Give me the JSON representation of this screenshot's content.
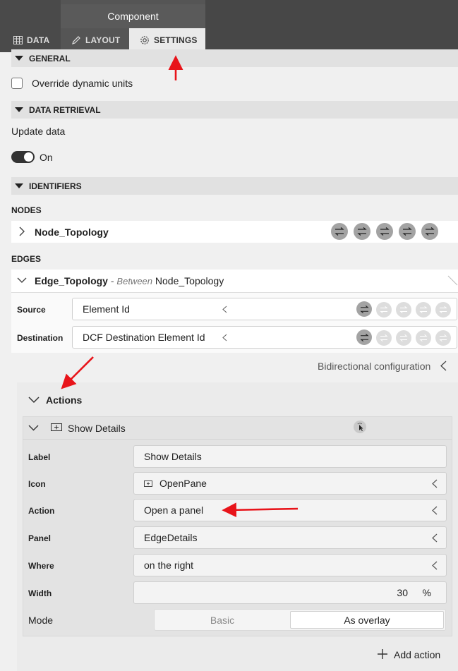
{
  "window": {
    "title": "Component"
  },
  "tabs": [
    {
      "label": "DATA",
      "icon": "table-icon"
    },
    {
      "label": "LAYOUT",
      "icon": "pencil-icon"
    },
    {
      "label": "SETTINGS",
      "icon": "gear-icon",
      "active": true
    }
  ],
  "general": {
    "header": "GENERAL",
    "override_label": "Override dynamic units",
    "override_checked": false
  },
  "data_retrieval": {
    "header": "DATA RETRIEVAL",
    "update_label": "Update data",
    "toggle_state": "On",
    "toggle_on": true
  },
  "identifiers": {
    "header": "IDENTIFIERS",
    "nodes_label": "NODES",
    "node_name": "Node_Topology",
    "edges_label": "EDGES",
    "edge_name": "Edge_Topology",
    "edge_sep": " - ",
    "edge_between": "Between",
    "edge_target": "Node_Topology",
    "source_label": "Source",
    "source_value": "Element Id",
    "destination_label": "Destination",
    "destination_value": "DCF Destination Element Id",
    "bidirectional_label": "Bidirectional configuration"
  },
  "actions": {
    "header": "Actions",
    "item_title": "Show Details",
    "fields": {
      "label_label": "Label",
      "label_value": "Show Details",
      "icon_label": "Icon",
      "icon_value": "OpenPane",
      "action_label": "Action",
      "action_value": "Open a panel",
      "panel_label": "Panel",
      "panel_value": "EdgeDetails",
      "where_label": "Where",
      "where_value": "on the right",
      "width_label": "Width",
      "width_value": "30",
      "width_unit": "%",
      "mode_label": "Mode",
      "mode_options": [
        "Basic",
        "As overlay"
      ],
      "mode_selected": "As overlay"
    },
    "add_label": "Add action"
  },
  "colors": {
    "topbar": "#555555",
    "annotation_arrow": "#e8141a",
    "toggle": "#333333"
  }
}
